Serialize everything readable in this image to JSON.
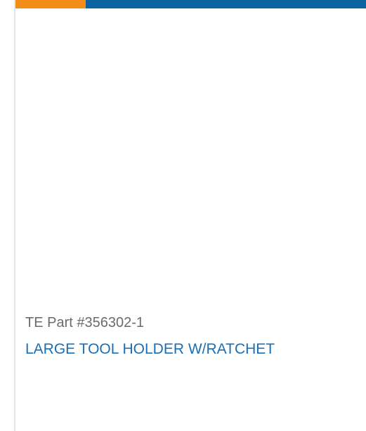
{
  "product": {
    "part_number": "TE Part #356302-1",
    "title": "LARGE TOOL HOLDER W/RATCHET"
  },
  "colors": {
    "accent": "#f28d1a",
    "brand": "#0b63a0",
    "title_link": "#1a6fb5",
    "part_text": "#6b6b6b"
  }
}
